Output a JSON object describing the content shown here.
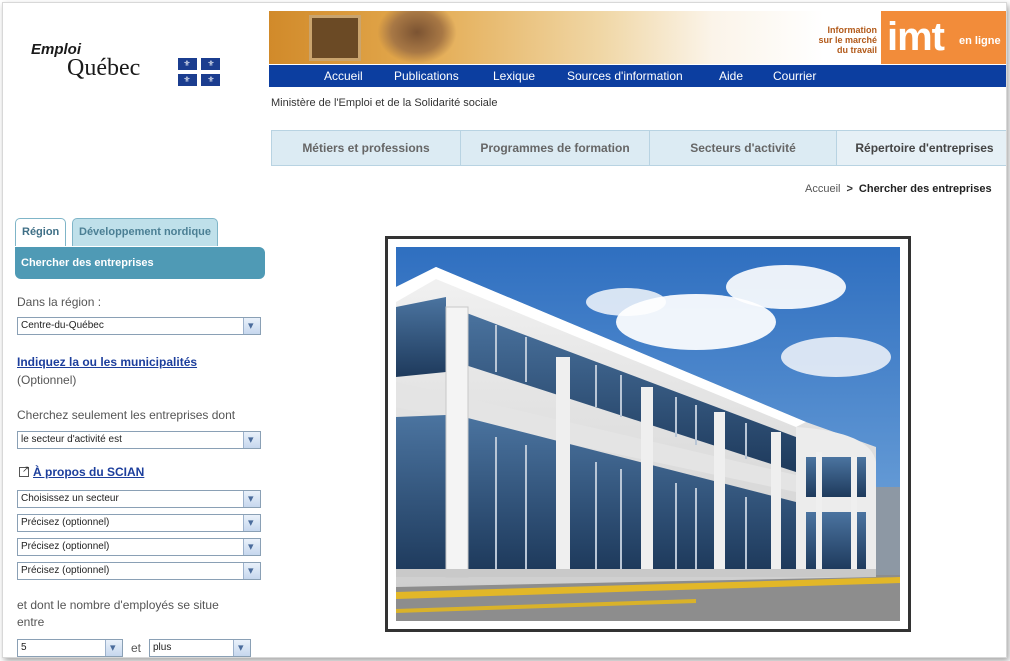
{
  "logo": {
    "line1": "Emploi",
    "line2": "Québec"
  },
  "banner": {
    "imt_caption": [
      "Information",
      "sur le marché",
      "du travail"
    ],
    "imt_logo": "imt",
    "imt_suffix": "en ligne"
  },
  "topnav": [
    "Accueil",
    "Publications",
    "Lexique",
    "Sources d'information",
    "Aide",
    "Courrier"
  ],
  "ministry": "Ministère de l'Emploi et de la Solidarité sociale",
  "tabs": [
    "Métiers et professions",
    "Programmes de formation",
    "Secteurs d'activité",
    "Répertoire d'entreprises"
  ],
  "breadcrumb": {
    "home": "Accueil",
    "sep": ">",
    "current": "Chercher des entreprises"
  },
  "sidebar": {
    "tabs": [
      "Région",
      "Développement nordique"
    ],
    "heading": "Chercher des entreprises",
    "region_label": "Dans la région :",
    "region_value": "Centre-du-Québec",
    "municipality_link": "Indiquez la ou les municipalités",
    "optional": "(Optionnel)",
    "filter_label": "Cherchez seulement les entreprises dont",
    "filter_value": "le secteur d'activité est",
    "scian_link": "À propos du SCIAN",
    "sector_value": "Choisissez un secteur",
    "precise_values": [
      "Précisez (optionnel)",
      "Précisez (optionnel)",
      "Précisez (optionnel)"
    ],
    "employees_label_1": "et dont le nombre d'employés se situe",
    "employees_label_2": "entre",
    "min_value": "5",
    "and": "et",
    "max_value": "plus"
  },
  "colors": {
    "nav": "#0c3ea0",
    "sidebar_head": "#4f9ab5",
    "imt": "#f28c3a",
    "link": "#1c3e9c"
  },
  "icons": [
    "quebec-flag-icon",
    "external-link-icon",
    "dropdown-arrow-icon"
  ]
}
